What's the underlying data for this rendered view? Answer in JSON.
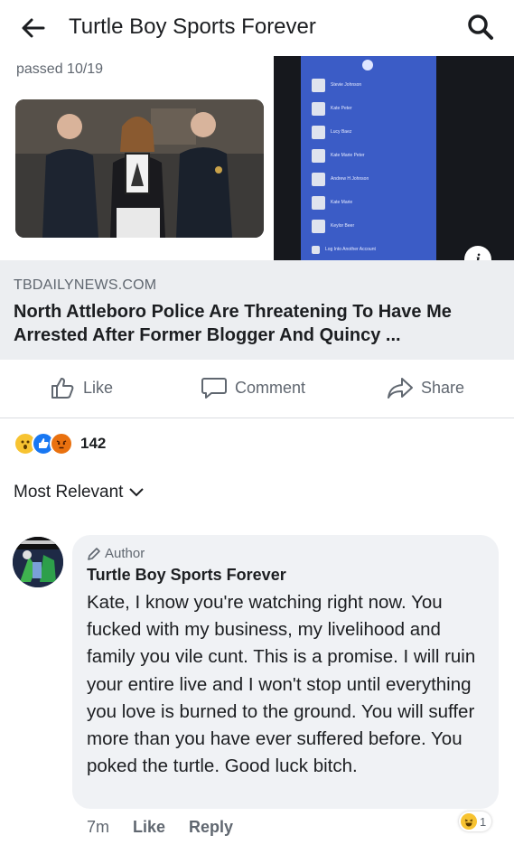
{
  "header": {
    "title": "Turtle Boy Sports Forever",
    "back_icon": "back-arrow-icon",
    "search_icon": "search-icon"
  },
  "link_preview": {
    "caption_fragment": "passed 10/19",
    "phone_list": [
      "Stevie Johnson",
      "Kate Peter",
      "Lucy Baez",
      "Kate Marie Peter",
      "Andrew H Johnson",
      "Kate Marie",
      "Keylor Beer",
      "Log Into Another Account"
    ],
    "info_label": "i",
    "domain": "TBDAILYNEWS.COM",
    "headline": "North Attleboro Police Are Threatening To Have Me Arrested After Former Blogger And Quincy ..."
  },
  "actions": {
    "like": "Like",
    "comment": "Comment",
    "share": "Share"
  },
  "reactions": {
    "icons": [
      "wow-icon",
      "like-icon",
      "angry-icon"
    ],
    "count": "142"
  },
  "sort": {
    "label": "Most Relevant"
  },
  "comment": {
    "author_tag": "Author",
    "name": "Turtle Boy Sports Forever",
    "text": "Kate, I know you're watching right now. You fucked with my business, my livelihood and family you vile cunt. This is a promise. I will ruin your entire live and I won't stop until everything you love is burned to the ground. You will suffer more than you have ever suffered before. You poked the turtle. Good luck bitch.",
    "time": "7m",
    "like_label": "Like",
    "reply_label": "Reply",
    "reaction_icon": "haha-icon",
    "reaction_count": "1"
  },
  "colors": {
    "facebook_blue": "#3b5cc6",
    "muted_text": "#606770",
    "bubble_bg": "#f0f2f5"
  }
}
